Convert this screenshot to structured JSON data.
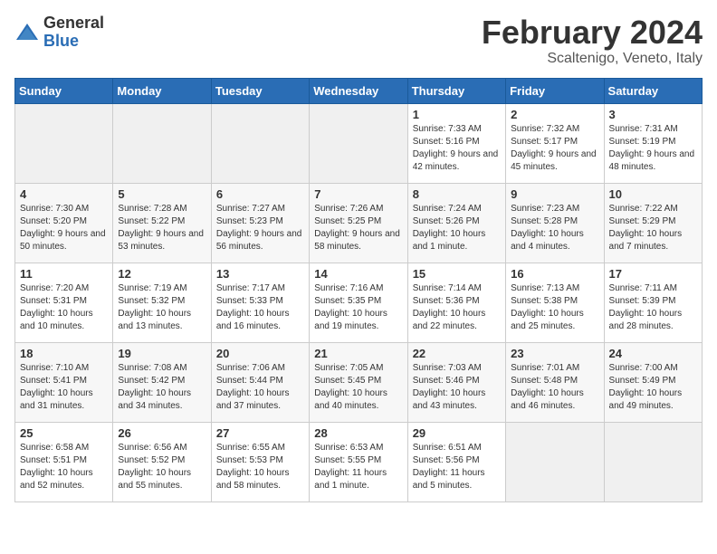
{
  "logo": {
    "general": "General",
    "blue": "Blue"
  },
  "header": {
    "month_year": "February 2024",
    "location": "Scaltenigo, Veneto, Italy"
  },
  "weekdays": [
    "Sunday",
    "Monday",
    "Tuesday",
    "Wednesday",
    "Thursday",
    "Friday",
    "Saturday"
  ],
  "weeks": [
    [
      {
        "num": "",
        "info": ""
      },
      {
        "num": "",
        "info": ""
      },
      {
        "num": "",
        "info": ""
      },
      {
        "num": "",
        "info": ""
      },
      {
        "num": "1",
        "info": "Sunrise: 7:33 AM\nSunset: 5:16 PM\nDaylight: 9 hours\nand 42 minutes."
      },
      {
        "num": "2",
        "info": "Sunrise: 7:32 AM\nSunset: 5:17 PM\nDaylight: 9 hours\nand 45 minutes."
      },
      {
        "num": "3",
        "info": "Sunrise: 7:31 AM\nSunset: 5:19 PM\nDaylight: 9 hours\nand 48 minutes."
      }
    ],
    [
      {
        "num": "4",
        "info": "Sunrise: 7:30 AM\nSunset: 5:20 PM\nDaylight: 9 hours\nand 50 minutes."
      },
      {
        "num": "5",
        "info": "Sunrise: 7:28 AM\nSunset: 5:22 PM\nDaylight: 9 hours\nand 53 minutes."
      },
      {
        "num": "6",
        "info": "Sunrise: 7:27 AM\nSunset: 5:23 PM\nDaylight: 9 hours\nand 56 minutes."
      },
      {
        "num": "7",
        "info": "Sunrise: 7:26 AM\nSunset: 5:25 PM\nDaylight: 9 hours\nand 58 minutes."
      },
      {
        "num": "8",
        "info": "Sunrise: 7:24 AM\nSunset: 5:26 PM\nDaylight: 10 hours\nand 1 minute."
      },
      {
        "num": "9",
        "info": "Sunrise: 7:23 AM\nSunset: 5:28 PM\nDaylight: 10 hours\nand 4 minutes."
      },
      {
        "num": "10",
        "info": "Sunrise: 7:22 AM\nSunset: 5:29 PM\nDaylight: 10 hours\nand 7 minutes."
      }
    ],
    [
      {
        "num": "11",
        "info": "Sunrise: 7:20 AM\nSunset: 5:31 PM\nDaylight: 10 hours\nand 10 minutes."
      },
      {
        "num": "12",
        "info": "Sunrise: 7:19 AM\nSunset: 5:32 PM\nDaylight: 10 hours\nand 13 minutes."
      },
      {
        "num": "13",
        "info": "Sunrise: 7:17 AM\nSunset: 5:33 PM\nDaylight: 10 hours\nand 16 minutes."
      },
      {
        "num": "14",
        "info": "Sunrise: 7:16 AM\nSunset: 5:35 PM\nDaylight: 10 hours\nand 19 minutes."
      },
      {
        "num": "15",
        "info": "Sunrise: 7:14 AM\nSunset: 5:36 PM\nDaylight: 10 hours\nand 22 minutes."
      },
      {
        "num": "16",
        "info": "Sunrise: 7:13 AM\nSunset: 5:38 PM\nDaylight: 10 hours\nand 25 minutes."
      },
      {
        "num": "17",
        "info": "Sunrise: 7:11 AM\nSunset: 5:39 PM\nDaylight: 10 hours\nand 28 minutes."
      }
    ],
    [
      {
        "num": "18",
        "info": "Sunrise: 7:10 AM\nSunset: 5:41 PM\nDaylight: 10 hours\nand 31 minutes."
      },
      {
        "num": "19",
        "info": "Sunrise: 7:08 AM\nSunset: 5:42 PM\nDaylight: 10 hours\nand 34 minutes."
      },
      {
        "num": "20",
        "info": "Sunrise: 7:06 AM\nSunset: 5:44 PM\nDaylight: 10 hours\nand 37 minutes."
      },
      {
        "num": "21",
        "info": "Sunrise: 7:05 AM\nSunset: 5:45 PM\nDaylight: 10 hours\nand 40 minutes."
      },
      {
        "num": "22",
        "info": "Sunrise: 7:03 AM\nSunset: 5:46 PM\nDaylight: 10 hours\nand 43 minutes."
      },
      {
        "num": "23",
        "info": "Sunrise: 7:01 AM\nSunset: 5:48 PM\nDaylight: 10 hours\nand 46 minutes."
      },
      {
        "num": "24",
        "info": "Sunrise: 7:00 AM\nSunset: 5:49 PM\nDaylight: 10 hours\nand 49 minutes."
      }
    ],
    [
      {
        "num": "25",
        "info": "Sunrise: 6:58 AM\nSunset: 5:51 PM\nDaylight: 10 hours\nand 52 minutes."
      },
      {
        "num": "26",
        "info": "Sunrise: 6:56 AM\nSunset: 5:52 PM\nDaylight: 10 hours\nand 55 minutes."
      },
      {
        "num": "27",
        "info": "Sunrise: 6:55 AM\nSunset: 5:53 PM\nDaylight: 10 hours\nand 58 minutes."
      },
      {
        "num": "28",
        "info": "Sunrise: 6:53 AM\nSunset: 5:55 PM\nDaylight: 11 hours\nand 1 minute."
      },
      {
        "num": "29",
        "info": "Sunrise: 6:51 AM\nSunset: 5:56 PM\nDaylight: 11 hours\nand 5 minutes."
      },
      {
        "num": "",
        "info": ""
      },
      {
        "num": "",
        "info": ""
      }
    ]
  ]
}
